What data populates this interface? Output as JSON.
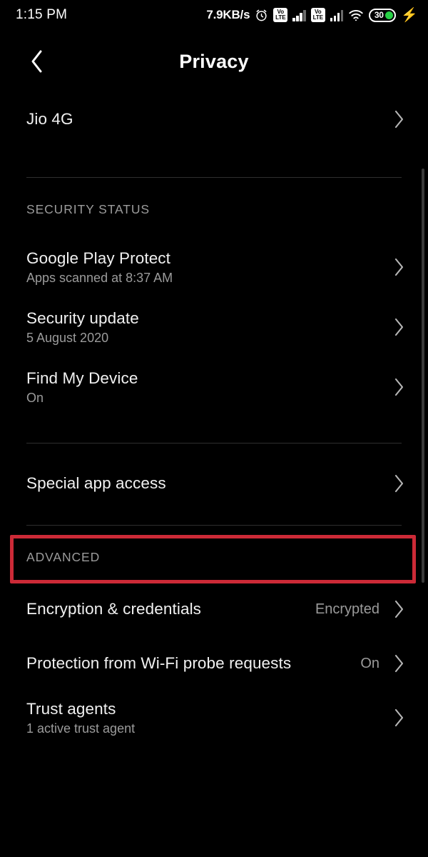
{
  "statusbar": {
    "clock": "1:15 PM",
    "network_speed": "7.9KB/s",
    "alarm_icon": "alarm-icon",
    "sim1": {
      "volte_top": "Vo",
      "volte_bottom": "LTE",
      "signal_icon": "signal-bars-icon"
    },
    "sim2": {
      "volte_top": "Vo",
      "volte_bottom": "LTE",
      "signal_icon": "signal-bars-icon"
    },
    "wifi_icon": "wifi-icon",
    "battery_level": "30",
    "battery_charging_icon": "lightning-bolt-icon",
    "battery_fill_color": "#27d045"
  },
  "appbar": {
    "back_icon": "back-chevron-icon",
    "title": "Privacy"
  },
  "list": {
    "jio": {
      "title": "Jio 4G",
      "chevron": "chevron-right-icon"
    },
    "security_status_header": "SECURITY STATUS",
    "google_play_protect": {
      "title": "Google Play Protect",
      "subtitle": "Apps scanned at 8:37 AM",
      "chevron": "chevron-right-icon"
    },
    "security_update": {
      "title": "Security update",
      "subtitle": "5 August 2020",
      "chevron": "chevron-right-icon"
    },
    "find_my_device": {
      "title": "Find My Device",
      "subtitle": "On",
      "chevron": "chevron-right-icon"
    },
    "special_app_access": {
      "title": "Special app access",
      "chevron": "chevron-right-icon",
      "highlight_color": "#cc2a37"
    },
    "advanced_header": "ADVANCED",
    "encryption": {
      "title": "Encryption & credentials",
      "value": "Encrypted",
      "chevron": "chevron-right-icon"
    },
    "wifi_probe": {
      "title": "Protection from Wi-Fi probe requests",
      "value": "On",
      "chevron": "chevron-right-icon"
    },
    "trust_agents": {
      "title": "Trust agents",
      "subtitle": "1 active trust agent",
      "chevron": "chevron-right-icon"
    }
  }
}
